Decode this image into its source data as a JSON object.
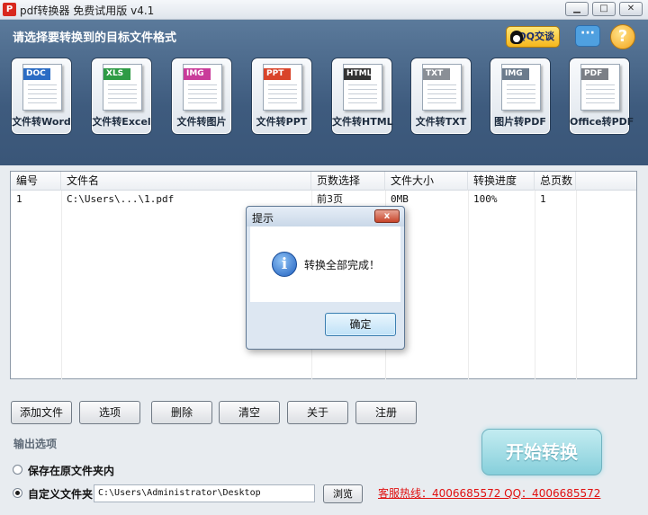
{
  "window": {
    "title": "pdf转换器 免费试用版 v4.1",
    "app_icon": "pdf-app-icon",
    "min_glyph": "▁",
    "max_glyph": "□",
    "close_glyph": "✕"
  },
  "header": {
    "title": "请选择要转换到的目标文件格式",
    "qq_label": "QQ交谈",
    "help_glyph": "?",
    "tools": [
      {
        "tag": "DOC",
        "label": "文件转Word",
        "color": "#2b6cc4"
      },
      {
        "tag": "XLS",
        "label": "文件转Excel",
        "color": "#2e9b45"
      },
      {
        "tag": "IMG",
        "label": "文件转图片",
        "color": "#c93c9a"
      },
      {
        "tag": "PPT",
        "label": "文件转PPT",
        "color": "#d9442a"
      },
      {
        "tag": "HTML",
        "label": "文件转HTML",
        "color": "#333333"
      },
      {
        "tag": "TXT",
        "label": "文件转TXT",
        "color": "#8a8f96"
      },
      {
        "tag": "IMG",
        "label": "图片转PDF",
        "color": "#6b7b8c"
      },
      {
        "tag": "PDF",
        "label": "Office转PDF",
        "color": "#7b7f86"
      }
    ]
  },
  "table": {
    "columns": [
      "编号",
      "文件名",
      "页数选择",
      "文件大小",
      "转换进度",
      "总页数"
    ],
    "rows": [
      [
        "1",
        "C:\\Users\\...\\1.pdf",
        "前3页",
        "0MB",
        "100%",
        "1"
      ]
    ]
  },
  "dialog": {
    "title": "提示",
    "close_glyph": "x",
    "message": "转换全部完成！",
    "ok_label": "确定",
    "icon_glyph": "i"
  },
  "buttons": {
    "add": "添加文件",
    "options": "选项",
    "delete": "删除",
    "clear": "清空",
    "about": "关于",
    "register": "注册"
  },
  "output": {
    "section_label": "输出选项",
    "option_original": "保存在原文件夹内",
    "option_custom": "自定义文件夹",
    "selected": "custom",
    "path": "C:\\Users\\Administrator\\Desktop",
    "browse_label": "浏览",
    "start_label": "开始转换",
    "hotline": "客服热线：4006685572 QQ：4006685572"
  }
}
